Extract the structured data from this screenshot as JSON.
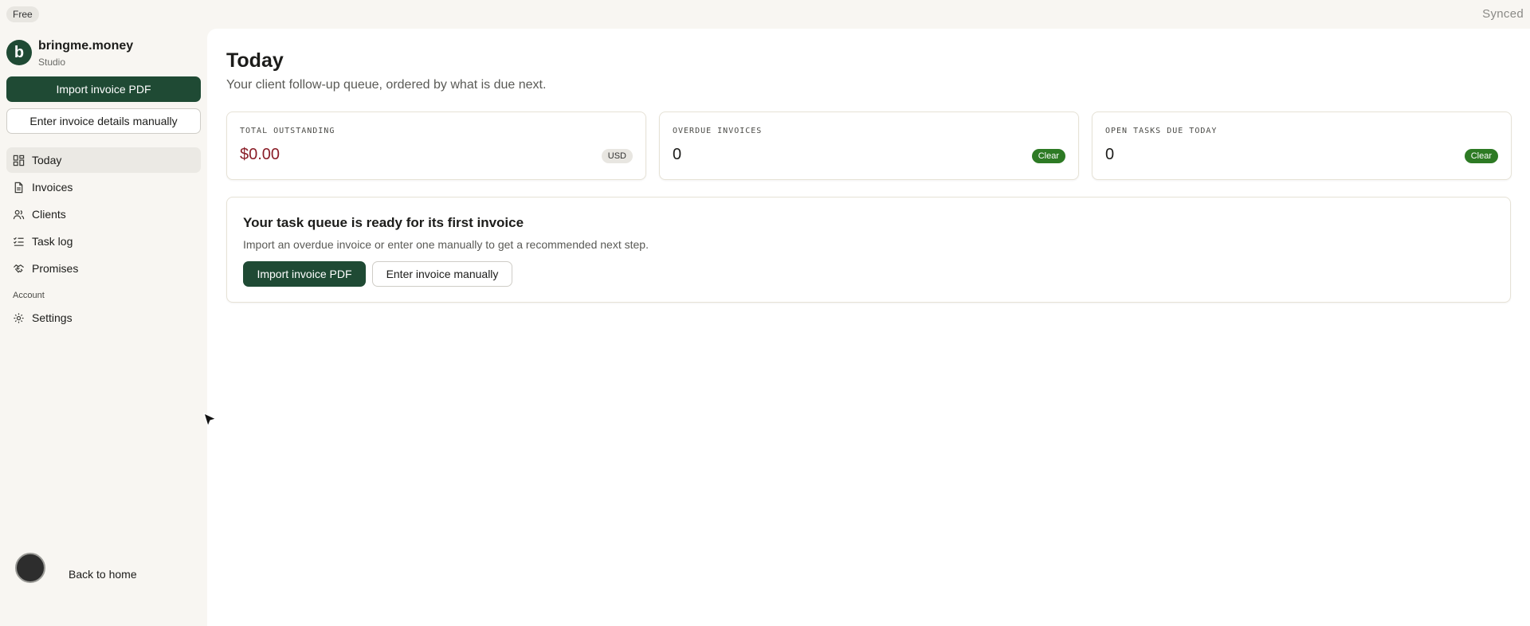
{
  "topbar": {
    "plan": "Free",
    "sync_status": "Synced"
  },
  "brand": {
    "initial": "b",
    "name": "bringme.money",
    "subtitle": "Studio"
  },
  "sidebar": {
    "import_label": "Import invoice PDF",
    "manual_label": "Enter invoice details manually",
    "nav": [
      {
        "label": "Today",
        "icon": "dashboard-icon"
      },
      {
        "label": "Invoices",
        "icon": "document-icon"
      },
      {
        "label": "Clients",
        "icon": "users-icon"
      },
      {
        "label": "Task log",
        "icon": "checklist-icon"
      },
      {
        "label": "Promises",
        "icon": "handshake-icon"
      }
    ],
    "account_heading": "Account",
    "settings_label": "Settings",
    "back_home": "Back to home"
  },
  "main": {
    "title": "Today",
    "subtitle": "Your client follow-up queue, ordered by what is due next.",
    "stats": [
      {
        "label": "TOTAL OUTSTANDING",
        "value": "$0.00",
        "badge": "USD"
      },
      {
        "label": "OVERDUE INVOICES",
        "value": "0",
        "badge": "Clear"
      },
      {
        "label": "OPEN TASKS DUE TODAY",
        "value": "0",
        "badge": "Clear"
      }
    ],
    "empty": {
      "title": "Your task queue is ready for its first invoice",
      "text": "Import an overdue invoice or enter one manually to get a recommended next step.",
      "import_label": "Import invoice PDF",
      "manual_label": "Enter invoice manually"
    }
  },
  "colors": {
    "brand_green": "#1f4a34",
    "success_green": "#2d7a24",
    "money_red": "#8a1e28",
    "sidebar_bg": "#f8f6f2"
  }
}
